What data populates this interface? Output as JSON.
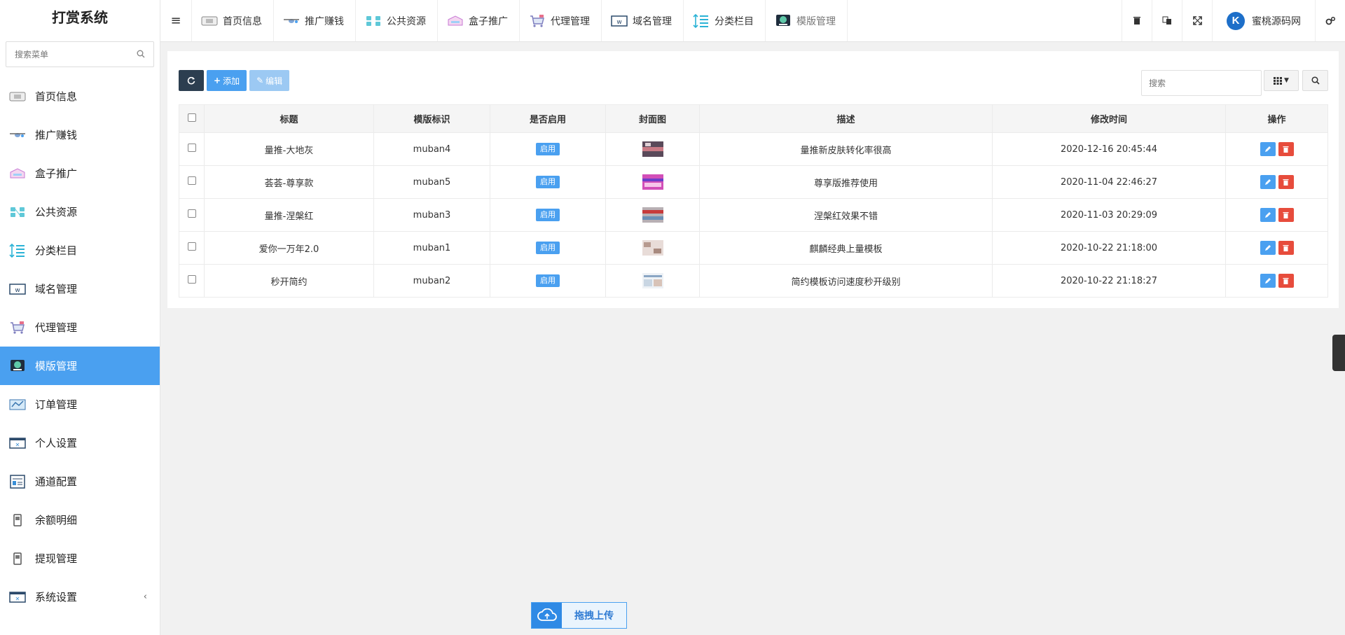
{
  "app": {
    "title": "打赏系统"
  },
  "sidebar": {
    "search_placeholder": "搜索菜单",
    "items": [
      {
        "label": "首页信息"
      },
      {
        "label": "推广赚钱"
      },
      {
        "label": "盒子推广"
      },
      {
        "label": "公共资源"
      },
      {
        "label": "分类栏目"
      },
      {
        "label": "域名管理"
      },
      {
        "label": "代理管理"
      },
      {
        "label": "模版管理"
      },
      {
        "label": "订单管理"
      },
      {
        "label": "个人设置"
      },
      {
        "label": "通道配置"
      },
      {
        "label": "余额明细"
      },
      {
        "label": "提现管理"
      },
      {
        "label": "系统设置"
      }
    ],
    "collapse_arrow": "‹"
  },
  "topnav": {
    "tabs": [
      {
        "label": "首页信息"
      },
      {
        "label": "推广赚钱"
      },
      {
        "label": "公共资源"
      },
      {
        "label": "盒子推广"
      },
      {
        "label": "代理管理"
      },
      {
        "label": "域名管理"
      },
      {
        "label": "分类栏目"
      },
      {
        "label": "模版管理"
      }
    ],
    "brand": "蜜桃源码网"
  },
  "toolbar": {
    "add_label": "添加",
    "edit_label": "编辑",
    "search_placeholder": "搜索"
  },
  "table": {
    "headers": [
      "标题",
      "模版标识",
      "是否启用",
      "封面图",
      "描述",
      "修改时间",
      "操作"
    ],
    "rows": [
      {
        "title": "量推-大地灰",
        "id": "muban4",
        "status": "启用",
        "desc": "量推新皮肤转化率很高",
        "time": "2020-12-16 20:45:44"
      },
      {
        "title": "荟荟-尊享款",
        "id": "muban5",
        "status": "启用",
        "desc": "尊享版推荐使用",
        "time": "2020-11-04 22:46:27"
      },
      {
        "title": "量推-涅槃红",
        "id": "muban3",
        "status": "启用",
        "desc": "涅槃红效果不错",
        "time": "2020-11-03 20:29:09"
      },
      {
        "title": "爱你一万年2.0",
        "id": "muban1",
        "status": "启用",
        "desc": "麒麟经典上量模板",
        "time": "2020-10-22 21:18:00"
      },
      {
        "title": "秒开简约",
        "id": "muban2",
        "status": "启用",
        "desc": "简约模板访问速度秒开级别",
        "time": "2020-10-22 21:18:27"
      }
    ]
  },
  "upload": {
    "label": "拖拽上传"
  },
  "colors": {
    "accent": "#4aa0f0",
    "dark": "#2c3e50",
    "danger": "#e74c3c"
  }
}
